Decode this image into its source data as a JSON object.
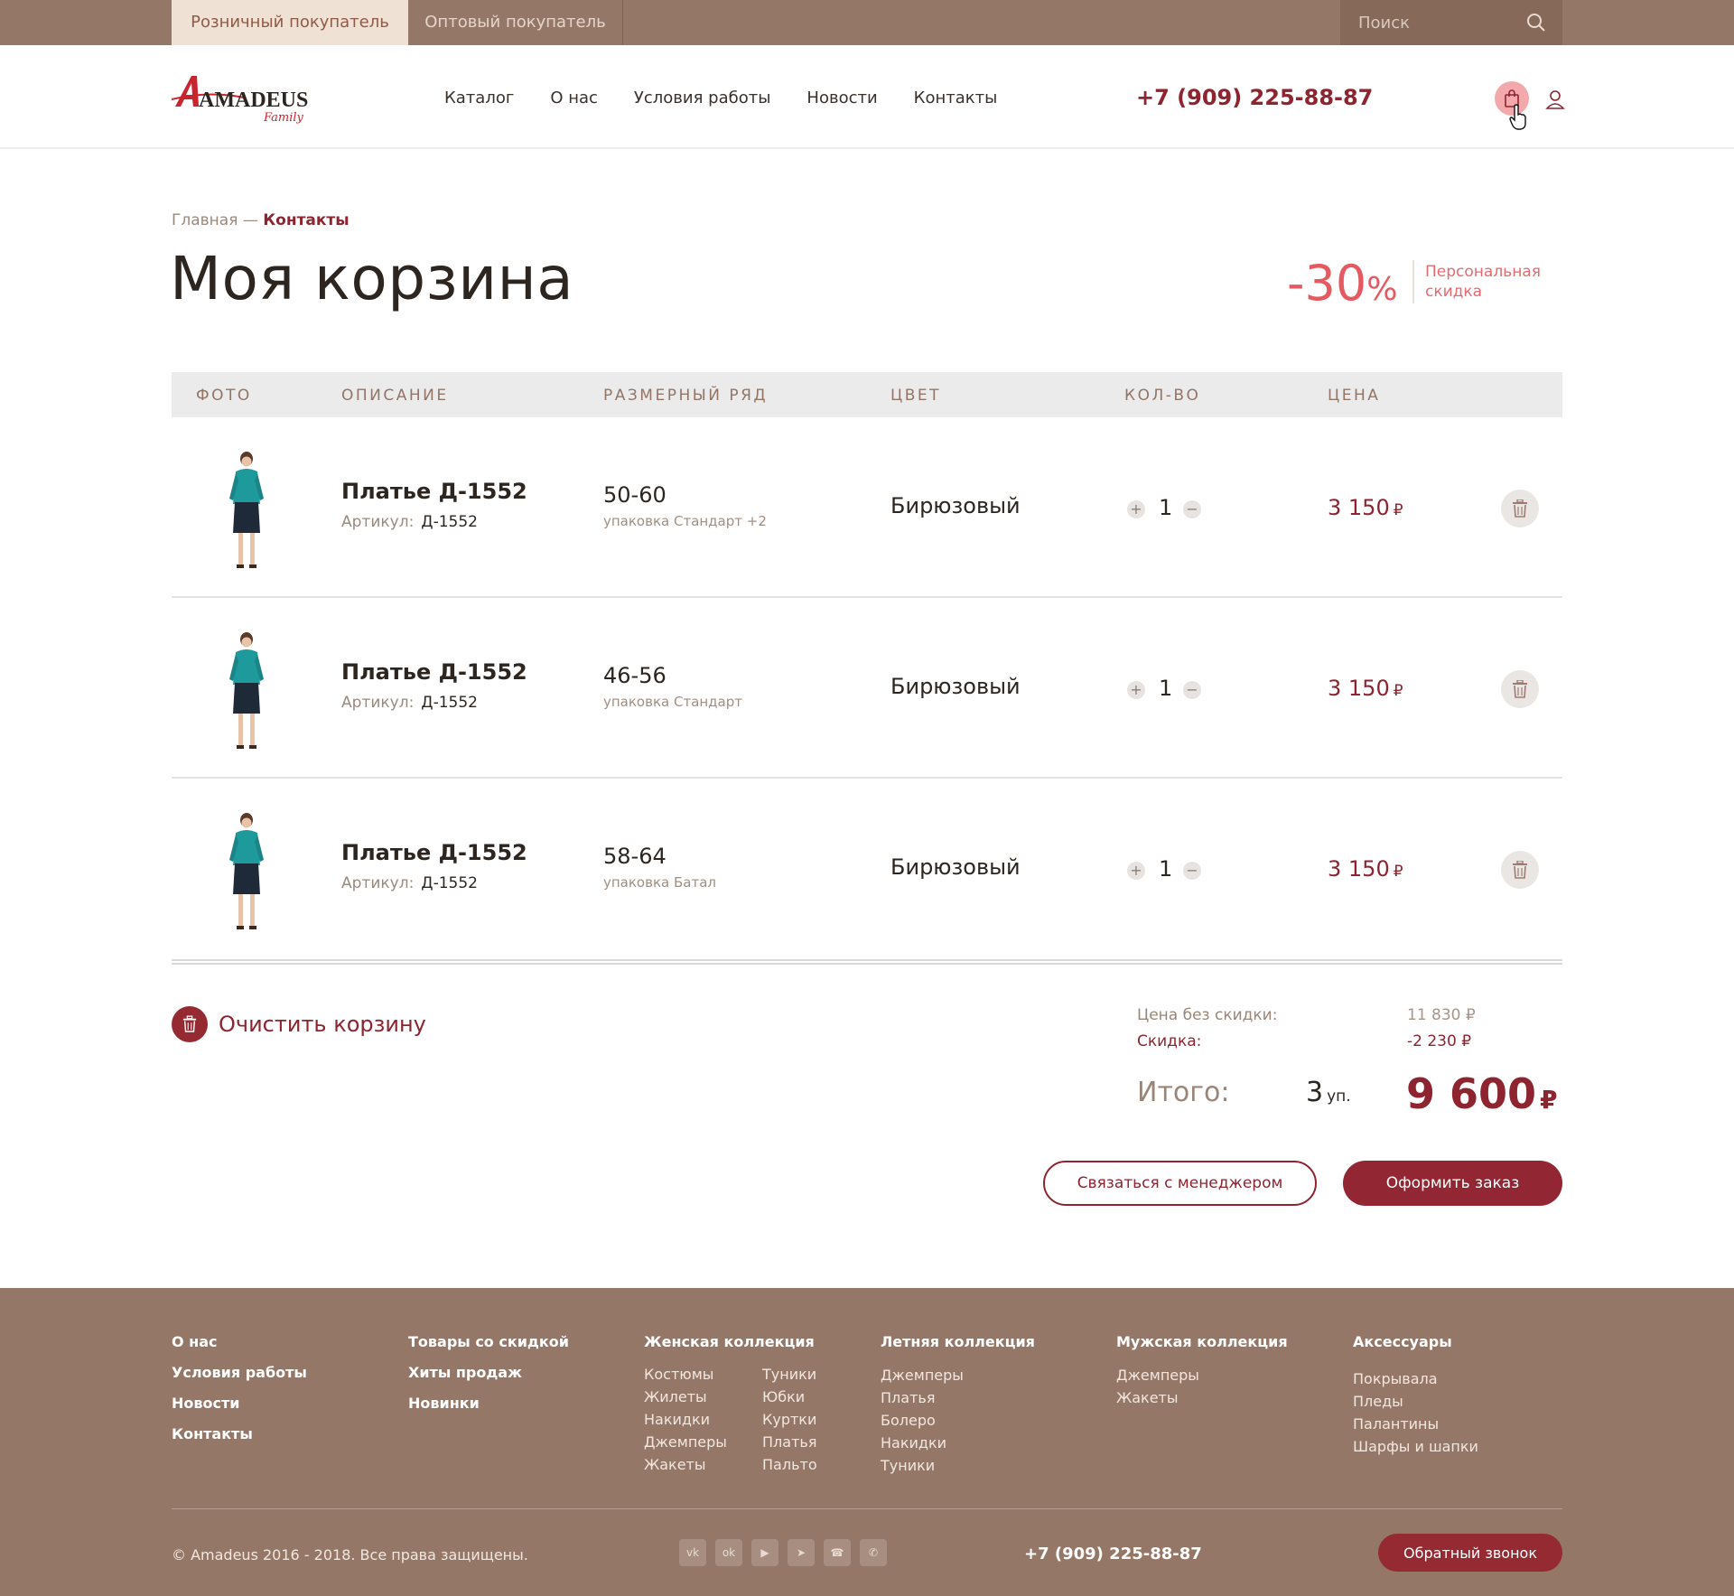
{
  "topbar": {
    "tab_retail": "Розничный покупатель",
    "tab_wholesale": "Оптовый покупатель",
    "search_placeholder": "Поиск"
  },
  "header": {
    "logo_text": "AMADEUS",
    "logo_sub": "Family",
    "nav": [
      "Каталог",
      "О нас",
      "Условия работы",
      "Новости",
      "Контакты"
    ],
    "phone": "+7 (909) 225-88-87"
  },
  "breadcrumb": {
    "home": "Главная",
    "sep": " — ",
    "current": "Контакты"
  },
  "page_title": "Моя корзина",
  "discount": {
    "value": "-30",
    "unit": "%",
    "label_line1": "Персональная",
    "label_line2": "скидка"
  },
  "table": {
    "headers": [
      "ФОТО",
      "ОПИСАНИЕ",
      "РАЗМЕРНЫЙ РЯД",
      "ЦВЕТ",
      "КОЛ-ВО",
      "ЦЕНА"
    ],
    "rows": [
      {
        "title": "Платье Д-1552",
        "article_label": "Артикул:",
        "article": "Д-1552",
        "size": "50-60",
        "pack": "упаковка Стандарт +2",
        "color": "Бирюзовый",
        "qty": "1",
        "price": "3 150",
        "currency": "₽"
      },
      {
        "title": "Платье Д-1552",
        "article_label": "Артикул:",
        "article": "Д-1552",
        "size": "46-56",
        "pack": "упаковка Стандарт",
        "color": "Бирюзовый",
        "qty": "1",
        "price": "3 150",
        "currency": "₽"
      },
      {
        "title": "Платье Д-1552",
        "article_label": "Артикул:",
        "article": "Д-1552",
        "size": "58-64",
        "pack": "упаковка Батал",
        "color": "Бирюзовый",
        "qty": "1",
        "price": "3 150",
        "currency": "₽"
      }
    ]
  },
  "summary": {
    "clear_label": "Очистить корзину",
    "no_discount_label": "Цена без скидки:",
    "no_discount_value": "11 830 ₽",
    "discount_label": "Скидка:",
    "discount_value": "-2 230 ₽",
    "total_label": "Итого:",
    "units": "3",
    "units_label": "уп.",
    "total": "9 600",
    "currency": "₽",
    "contact_manager": "Связаться с менеджером",
    "checkout": "Оформить заказ"
  },
  "footer": {
    "col1": [
      "О нас",
      "Условия работы",
      "Новости",
      "Контакты"
    ],
    "col2": [
      "Товары со скидкой",
      "Хиты продаж",
      "Новинки"
    ],
    "women": {
      "title": "Женская коллекция",
      "a": [
        "Костюмы",
        "Жилеты",
        "Накидки",
        "Джемперы",
        "Жакеты"
      ],
      "b": [
        "Туники",
        "Юбки",
        "Куртки",
        "Платья",
        "Пальто"
      ]
    },
    "summer": {
      "title": "Летняя коллекция",
      "items": [
        "Джемперы",
        "Платья",
        "Болеро",
        "Накидки",
        "Туники"
      ]
    },
    "men": {
      "title": "Мужская коллекция",
      "items": [
        "Джемперы",
        "Жакеты"
      ]
    },
    "accessories": {
      "title": "Аксессуары",
      "items": [
        "Покрывала",
        "Пледы",
        "Палантины",
        "Шарфы и шапки"
      ]
    },
    "copyright": "© Amadeus 2016 - 2018. Все права защищены.",
    "social": [
      "vk-icon",
      "odnoklassniki-icon",
      "youtube-icon",
      "telegram-icon",
      "viber-icon",
      "whatsapp-icon"
    ],
    "phone": "+7 (909) 225-88-87",
    "callback": "Обратный звонок"
  },
  "colors": {
    "brand": "#8d2430",
    "topbar": "#957767",
    "accent_discount": "#e55a60"
  }
}
